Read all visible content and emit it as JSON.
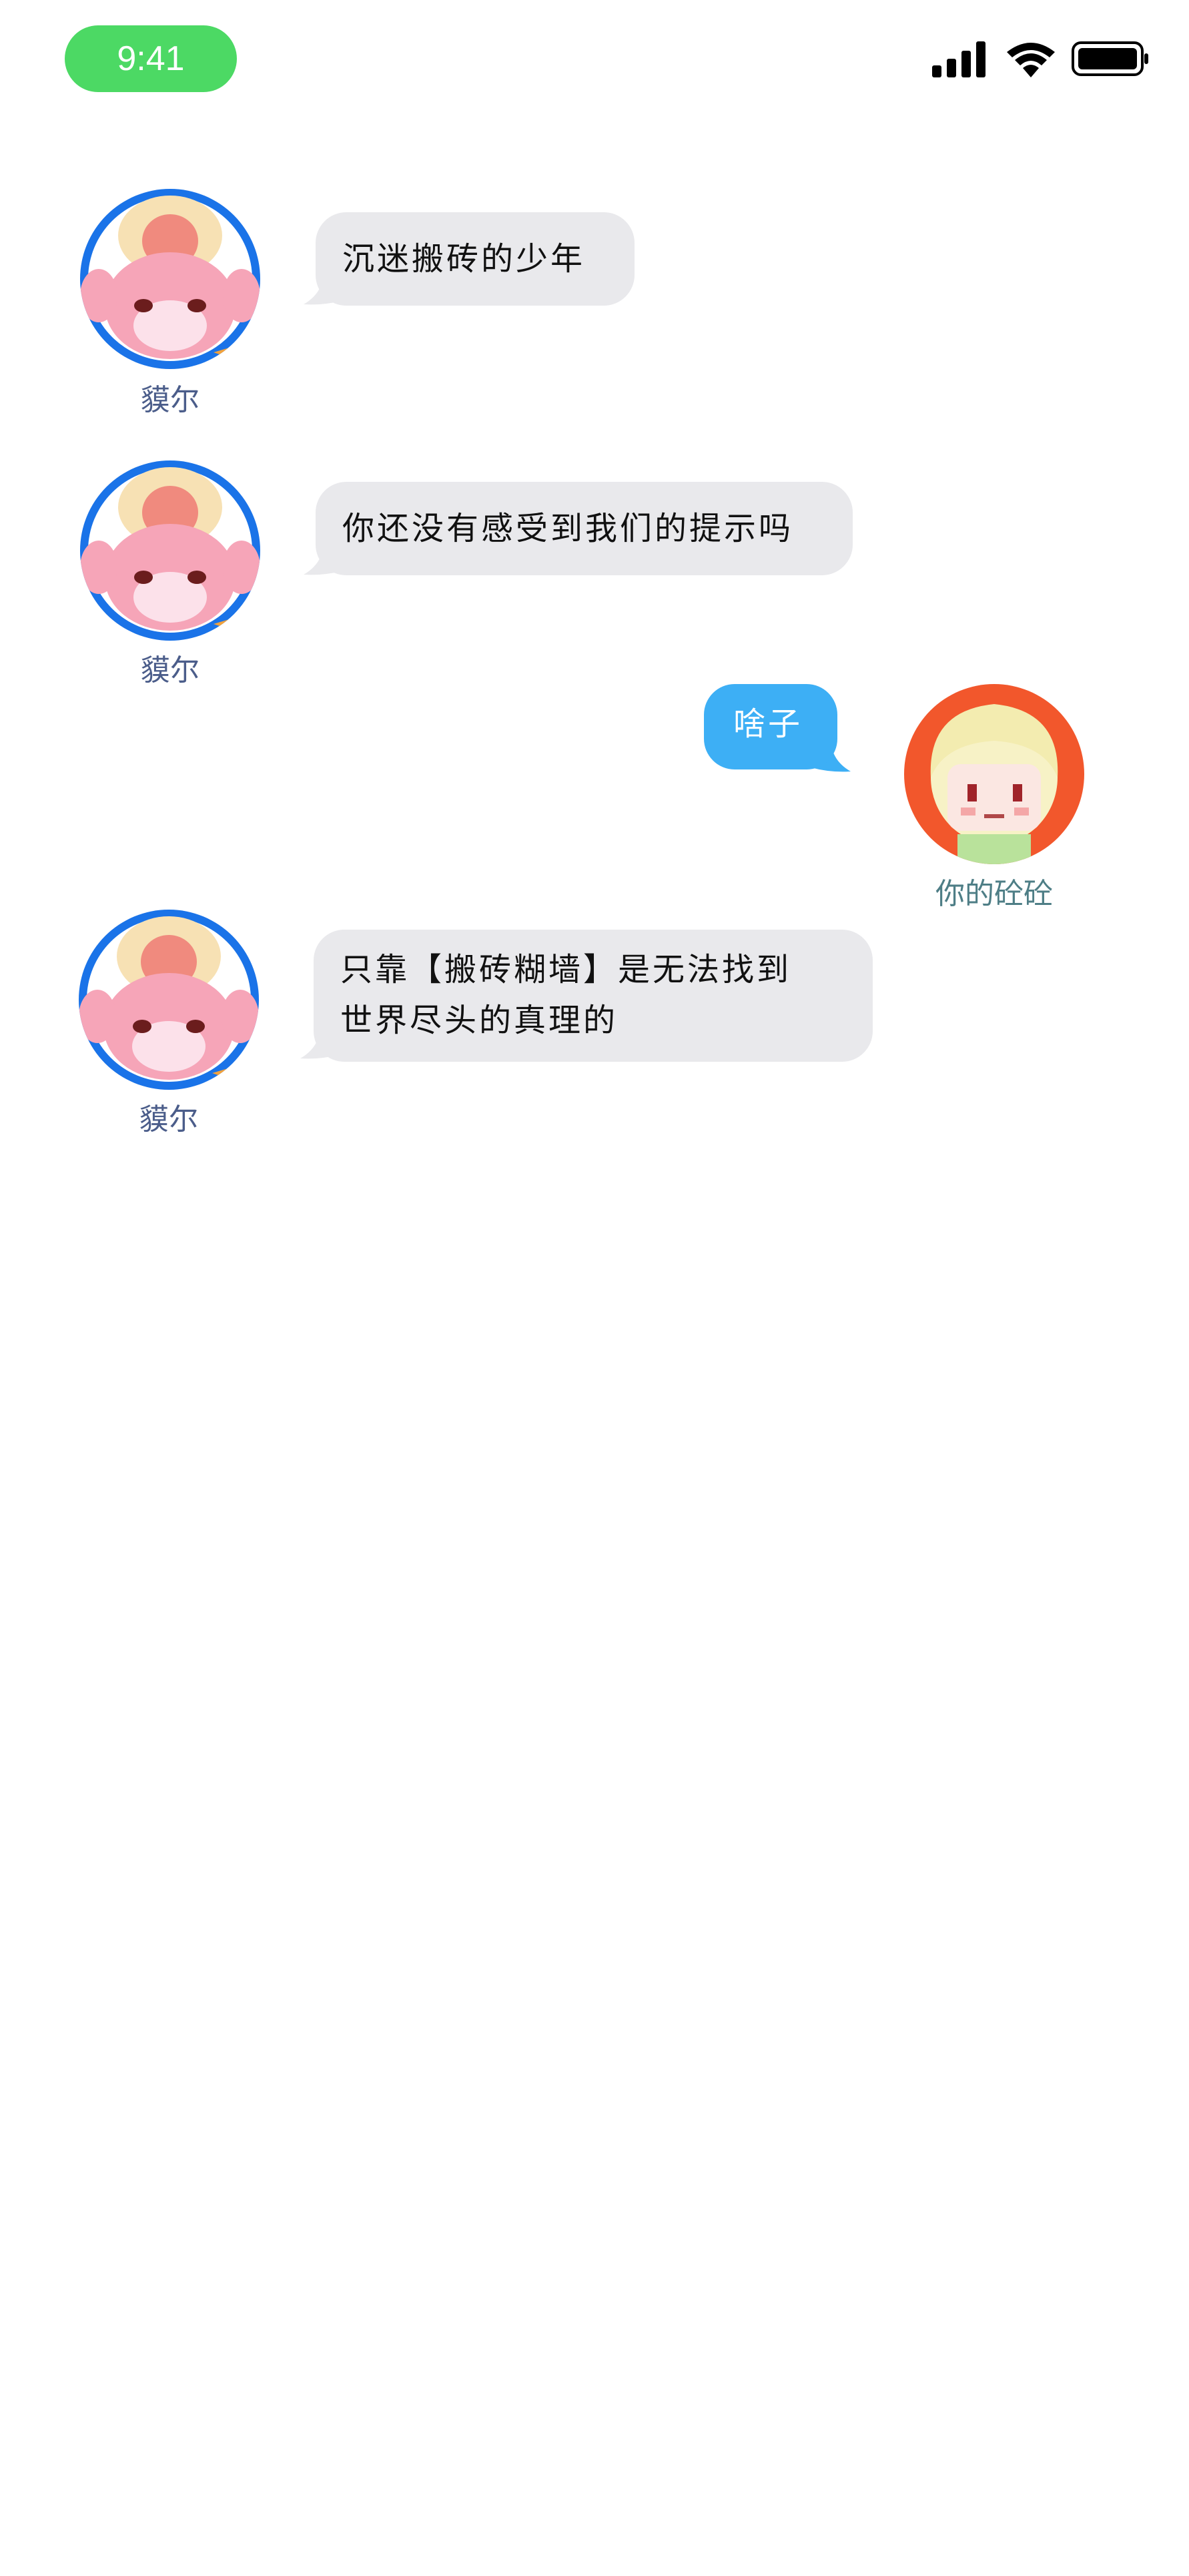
{
  "status_bar": {
    "time": "9:41",
    "time_pill_color": "#4cd964",
    "icons": [
      "cellular-signal-icon",
      "wifi-icon",
      "battery-icon"
    ]
  },
  "conversation": {
    "messages": [
      {
        "sender": "貘尔",
        "side": "left",
        "avatar": "pink-creature-avatar",
        "text": "沉迷搬砖的少年"
      },
      {
        "sender": "貘尔",
        "side": "left",
        "avatar": "pink-creature-avatar",
        "text": "你还没有感受到我们的提示吗"
      },
      {
        "sender": "你的砼砼",
        "side": "right",
        "avatar": "blonde-character-avatar",
        "text": "啥子"
      },
      {
        "sender": "貘尔",
        "side": "left",
        "avatar": "pink-creature-avatar",
        "text": "只靠【搬砖糊墙】是无法找到\n世界尽头的真理的"
      }
    ]
  },
  "colors": {
    "incoming_bubble": "#e9e9ec",
    "outgoing_bubble": "#3daff5",
    "mole_avatar_ring": "#1a73e8",
    "me_avatar_bg": "#f2572c"
  }
}
